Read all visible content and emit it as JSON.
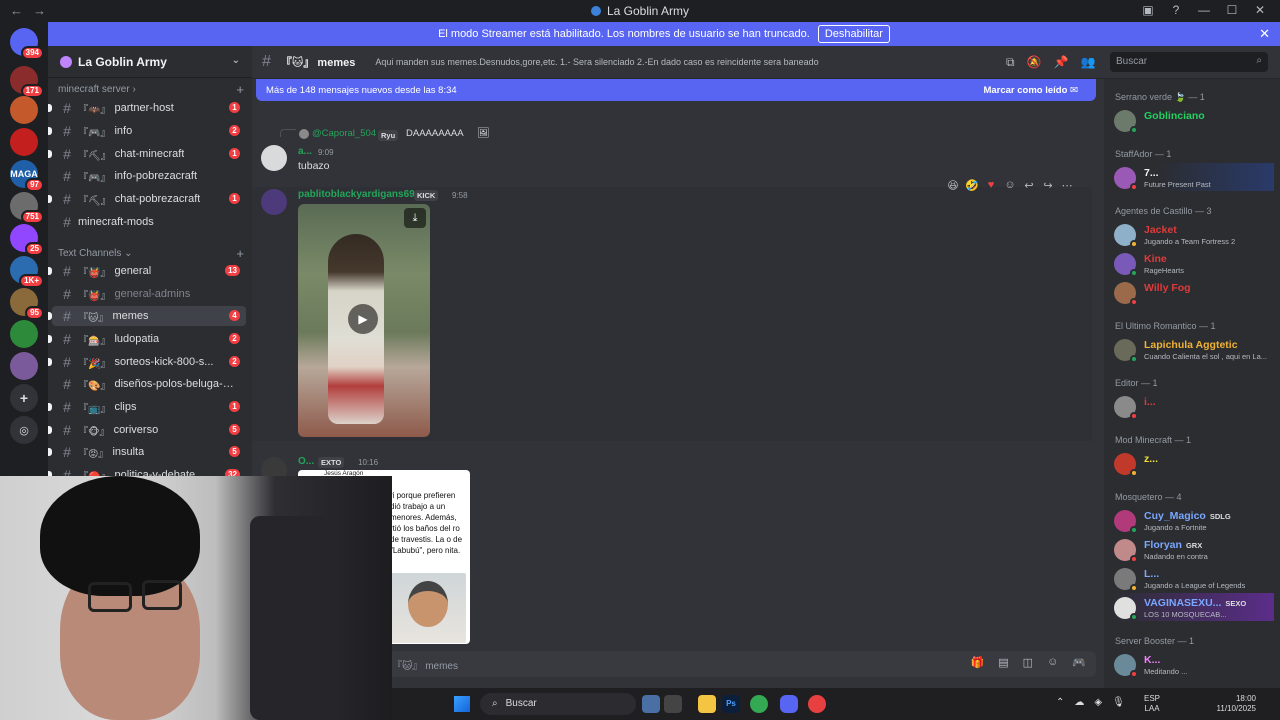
{
  "window": {
    "title": "La Goblin Army"
  },
  "banner": {
    "text": "El modo Streamer está habilitado. Los nombres de usuario se han truncado.",
    "button": "Deshabilitar"
  },
  "rail": [
    {
      "badge": "394",
      "color": "#5865f2",
      "label": ""
    },
    {
      "badge": "171",
      "color": "#8b2c2c",
      "label": ""
    },
    {
      "badge": "",
      "color": "#c45a2c",
      "label": ""
    },
    {
      "badge": "",
      "color": "#c41f1f",
      "label": ""
    },
    {
      "badge": "97",
      "color": "#1f5fa8",
      "label": "MAGA"
    },
    {
      "badge": "751",
      "color": "#6c6c6c",
      "label": ""
    },
    {
      "badge": "25",
      "color": "#9146ff",
      "label": ""
    },
    {
      "badge": "1K+",
      "color": "#2b6cb0",
      "label": ""
    },
    {
      "badge": "95",
      "color": "#8a6a3a",
      "label": ""
    },
    {
      "badge": "",
      "color": "#2d8a3a",
      "label": ""
    },
    {
      "badge": "",
      "color": "#7a5a9a",
      "label": ""
    }
  ],
  "sidebar": {
    "server_name": "La Goblin Army",
    "category_1": "minecraft server",
    "category_2": "Text Channels",
    "channels": [
      {
        "emo": "『🦇』",
        "name": "partner-host",
        "count": "1"
      },
      {
        "emo": "『🎮』",
        "name": "info",
        "count": "2"
      },
      {
        "emo": "『⛏』",
        "name": "chat-minecraft",
        "count": "1"
      },
      {
        "emo": "『🎮』",
        "name": "info-pobrezacraft",
        "count": ""
      },
      {
        "emo": "『⛏』",
        "name": "chat-pobrezacraft",
        "count": "1"
      },
      {
        "emo": "",
        "name": "minecraft-mods",
        "count": ""
      },
      {
        "emo": "『👹』",
        "name": "general",
        "count": "13"
      },
      {
        "emo": "『👹』",
        "name": "general-admins",
        "count": ""
      },
      {
        "emo": "『🐱』",
        "name": "memes",
        "count": "4"
      },
      {
        "emo": "『🎰』",
        "name": "ludopatia",
        "count": "2"
      },
      {
        "emo": "『🎉』",
        "name": "sorteos-kick-800-s...",
        "count": "2"
      },
      {
        "emo": "『🎨』",
        "name": "diseños-polos-beluga-ar...",
        "count": ""
      },
      {
        "emo": "『📺』",
        "name": "clips",
        "count": "1"
      },
      {
        "emo": "『🐵』",
        "name": "coriverso",
        "count": "5"
      },
      {
        "emo": "『😡』",
        "name": "insulta",
        "count": "5"
      },
      {
        "emo": "『🔴』",
        "name": "politica-y-debate",
        "count": "32"
      }
    ]
  },
  "header": {
    "channel": "『🐱』 memes",
    "topic": "Aqui manden sus memes.Desnudos,gore,etc. 1.- Sera silenciado 2.-En dado caso es reincidente sera baneado",
    "search_placeholder": "Buscar"
  },
  "chat": {
    "new_messages": "Más de 148 mensajes nuevos desde las 8:34",
    "mark_read": "Marcar como leído",
    "reply_user": "@Caporal_504",
    "reply_tag": "Ryu",
    "reply_text": "DAAAAAAAA",
    "msg1_user": "a...",
    "msg1_time": "9:09",
    "msg1_text": "tubazo",
    "msg2_user": "pablitoblackyardigans69",
    "msg2_tag": "KICK",
    "msg2_time": "9:58",
    "msg3_user": "O...",
    "msg3_tag": "EXTO",
    "msg3_time": "10:16",
    "card_name": "Jesús Aragón",
    "card_text": "ri porque prefieren dió trabajo a un menores. Además, rtió los baños del ro de travestis. La o de \"Labubú\", pero nita.",
    "composer": "『🐱』 memes"
  },
  "members": {
    "groups": [
      {
        "title": "Serrano verde 🍃 — 1",
        "items": [
          {
            "name": "Goblinciano",
            "color": "#23d160",
            "activity": "",
            "tag": "",
            "av": "#6b7a6a"
          }
        ]
      },
      {
        "title": "StaffAdor — 1",
        "items": [
          {
            "name": "7...",
            "color": "#f2f3f5",
            "activity": "Future Present Past",
            "tag": "",
            "av": "#9b59b6"
          }
        ]
      },
      {
        "title": "Agentes de Castillo — 3",
        "items": [
          {
            "name": "Jacket",
            "color": "#e03a3a",
            "activity": "Jugando a Team Fortress 2",
            "tag": "",
            "av": "#8fb0c9"
          },
          {
            "name": "Kine",
            "color": "#e03a3a",
            "activity": "RageHearts",
            "tag": "",
            "av": "#7a5ab8"
          },
          {
            "name": "Willy Fog",
            "color": "#e03a3a",
            "activity": "",
            "tag": "",
            "av": "#9a6a4a"
          }
        ]
      },
      {
        "title": "El Ultimo Romantico — 1",
        "items": [
          {
            "name": "Lapichula Aggtetic",
            "color": "#f0b232",
            "activity": "Cuando Calienta el sol , aqui en La...",
            "tag": "",
            "av": "#6a6a5a"
          }
        ]
      },
      {
        "title": "Editor — 1",
        "items": [
          {
            "name": "i...",
            "color": "#e03a3a",
            "activity": "",
            "tag": "",
            "av": "#8a8a8a"
          }
        ]
      },
      {
        "title": "Mod Minecraft — 1",
        "items": [
          {
            "name": "z...",
            "color": "#f0e232",
            "activity": "",
            "tag": "",
            "av": "#c0392b"
          }
        ]
      },
      {
        "title": "Mosquetero — 4",
        "items": [
          {
            "name": "Cuy_Magico",
            "color": "#7aa7ff",
            "activity": "Jugando a Fortnite",
            "tag": "SDLG",
            "av": "#b03a7a"
          },
          {
            "name": "Floryan",
            "color": "#7aa7ff",
            "activity": "Nadando en contra",
            "tag": "GRX",
            "av": "#c08a8a"
          },
          {
            "name": "L...",
            "color": "#7aa7ff",
            "activity": "Jugando a League of Legends",
            "tag": "",
            "av": "#7a7a7a"
          },
          {
            "name": "VAGINASEXU...",
            "color": "#7aa7ff",
            "activity": "LOS 10 MOSQUECAB...",
            "tag": "SEXO",
            "av": "#e0e0e0"
          }
        ]
      },
      {
        "title": "Server Booster — 1",
        "items": [
          {
            "name": "K...",
            "color": "#f47fff",
            "activity": "Meditando ...",
            "tag": "",
            "av": "#6a8a9a"
          }
        ]
      }
    ]
  },
  "taskbar": {
    "search": "Buscar",
    "lang_1": "ESP",
    "lang_2": "LAA",
    "time": "18:00",
    "date": "11/10/2025"
  }
}
